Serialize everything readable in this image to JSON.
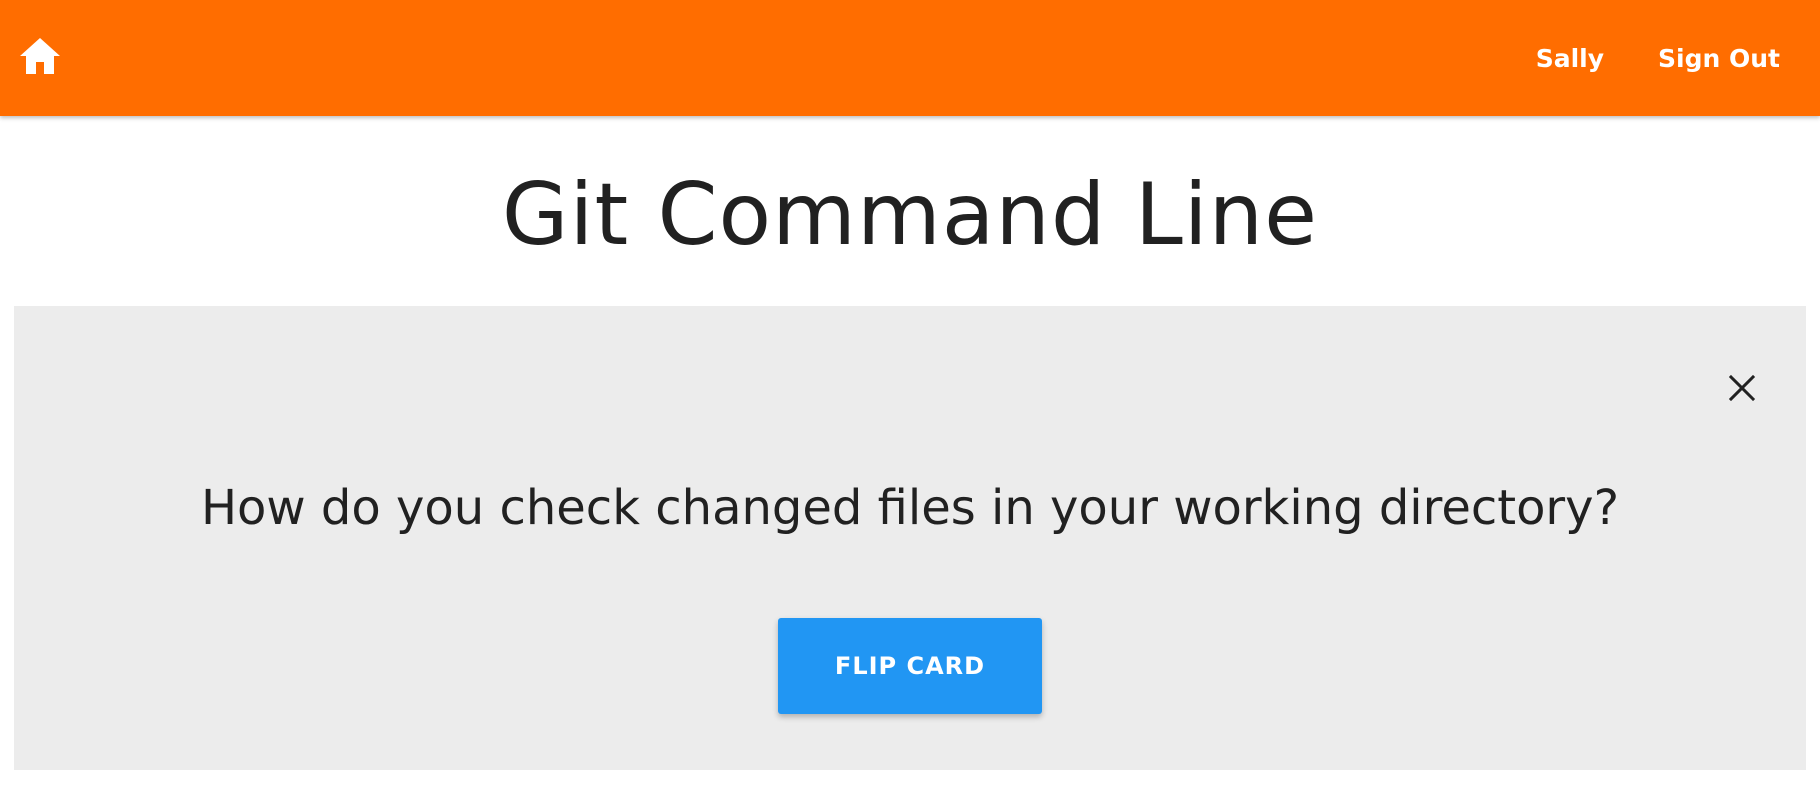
{
  "navbar": {
    "home_icon": "home-icon",
    "user_name": "Sally",
    "sign_out_label": "Sign Out",
    "background_color": "#ff6d00"
  },
  "page": {
    "title": "Git Command Line"
  },
  "card": {
    "question": "How do you check changed files in your working directory?",
    "close_icon": "close-icon",
    "flip_label": "FLIP CARD",
    "background_color": "#ececec",
    "button_color": "#2196f3"
  }
}
